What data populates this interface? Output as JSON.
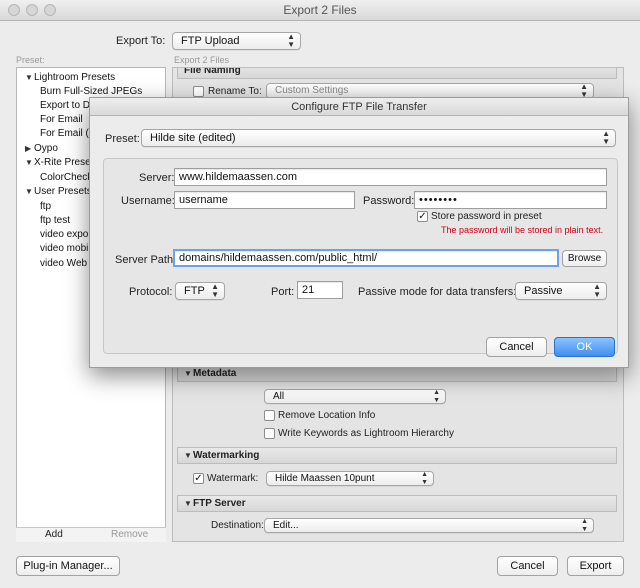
{
  "window": {
    "title": "Export 2 Files"
  },
  "export_to": {
    "label": "Export To:",
    "value": "FTP Upload"
  },
  "preset_header": "Preset:",
  "section_header": "Export 2 Files",
  "presets": [
    {
      "label": "Lightroom Presets",
      "expanded": true,
      "indent": 0
    },
    {
      "label": "Burn Full-Sized JPEGs",
      "indent": 1
    },
    {
      "label": "Export to DNG",
      "indent": 1
    },
    {
      "label": "For Email",
      "indent": 1
    },
    {
      "label": "For Email (Hard Drive)",
      "indent": 1
    },
    {
      "label": "Oypo",
      "expanded": false,
      "indent": 0
    },
    {
      "label": "X-Rite Presets",
      "expanded": true,
      "indent": 0
    },
    {
      "label": "ColorChecker Passport",
      "indent": 1
    },
    {
      "label": "User Presets",
      "expanded": true,
      "indent": 0
    },
    {
      "label": "ftp",
      "indent": 1
    },
    {
      "label": "ftp test",
      "indent": 1
    },
    {
      "label": "video export",
      "indent": 1
    },
    {
      "label": "video mobile",
      "indent": 1
    },
    {
      "label": "video Web export",
      "indent": 1
    }
  ],
  "preset_buttons": {
    "add": "Add",
    "remove": "Remove"
  },
  "file_naming": {
    "header": "File Naming",
    "rename_label": "Rename To:",
    "rename_value": "Custom Settings"
  },
  "metadata": {
    "header": "Metadata",
    "include_value": "All",
    "remove_location": "Remove Location Info",
    "write_keywords": "Write Keywords as Lightroom Hierarchy"
  },
  "watermarking": {
    "header": "Watermarking",
    "label": "Watermark:",
    "checked": true,
    "value": "Hilde Maassen 10punt"
  },
  "ftp_server": {
    "header": "FTP Server",
    "destination_label": "Destination:",
    "destination_value": "Edit..."
  },
  "footer": {
    "plugin_manager": "Plug-in Manager...",
    "cancel": "Cancel",
    "export": "Export"
  },
  "dialog": {
    "title": "Configure FTP File Transfer",
    "preset_label": "Preset:",
    "preset_value": "Hilde site (edited)",
    "server_label": "Server:",
    "server_value": "www.hildemaassen.com",
    "username_label": "Username:",
    "username_value": "username",
    "password_label": "Password:",
    "password_value": "••••••••",
    "store_password": "Store password in preset",
    "store_password_checked": true,
    "warning": "The password will be stored in plain text.",
    "server_path_label": "Server Path:",
    "server_path_value": "domains/hildemaassen.com/public_html/",
    "browse": "Browse",
    "protocol_label": "Protocol:",
    "protocol_value": "FTP",
    "port_label": "Port:",
    "port_value": "21",
    "passive_label": "Passive mode for data transfers:",
    "passive_value": "Passive",
    "cancel": "Cancel",
    "ok": "OK"
  },
  "colors": {
    "accent": "#3f8ef1",
    "warning": "#d0021b"
  }
}
